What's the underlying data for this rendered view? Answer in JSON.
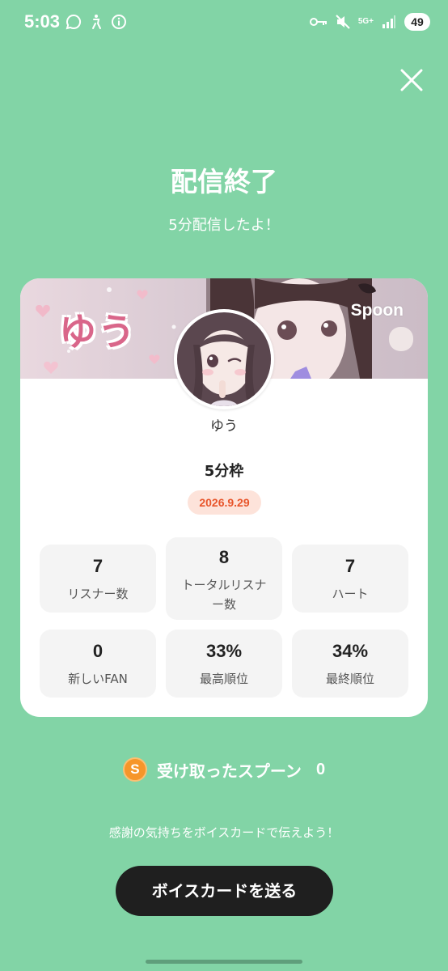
{
  "status_bar": {
    "time": "5:03",
    "network": "5G+",
    "battery": "49"
  },
  "header": {
    "title": "配信終了",
    "subtitle": "5分配信したよ！"
  },
  "card": {
    "brand": "Spoon",
    "banner_name": "ゆう",
    "username": "ゆう",
    "slot": "5分枠",
    "date": "2026.9.29",
    "stats": [
      {
        "value": "7",
        "label": "リスナー数"
      },
      {
        "value": "8",
        "label_line1": "トータルリスナ",
        "label_line2": "ー数"
      },
      {
        "value": "7",
        "label": "ハート"
      },
      {
        "value": "0",
        "label": "新しいFAN"
      },
      {
        "value": "33%",
        "label": "最高順位"
      },
      {
        "value": "34%",
        "label": "最終順位"
      }
    ]
  },
  "spoons": {
    "coin_symbol": "S",
    "label": "受け取ったスプーン",
    "count": "0"
  },
  "voice_card": {
    "hint": "感謝の気持ちをボイスカードで伝えよう！",
    "button_label": "ボイスカードを送る"
  },
  "colors": {
    "background": "#82d4a6",
    "date_badge_text": "#e8552b",
    "date_badge_bg": "#fde3da",
    "button_bg": "#1f1f1f",
    "coin": "#f6962a"
  }
}
